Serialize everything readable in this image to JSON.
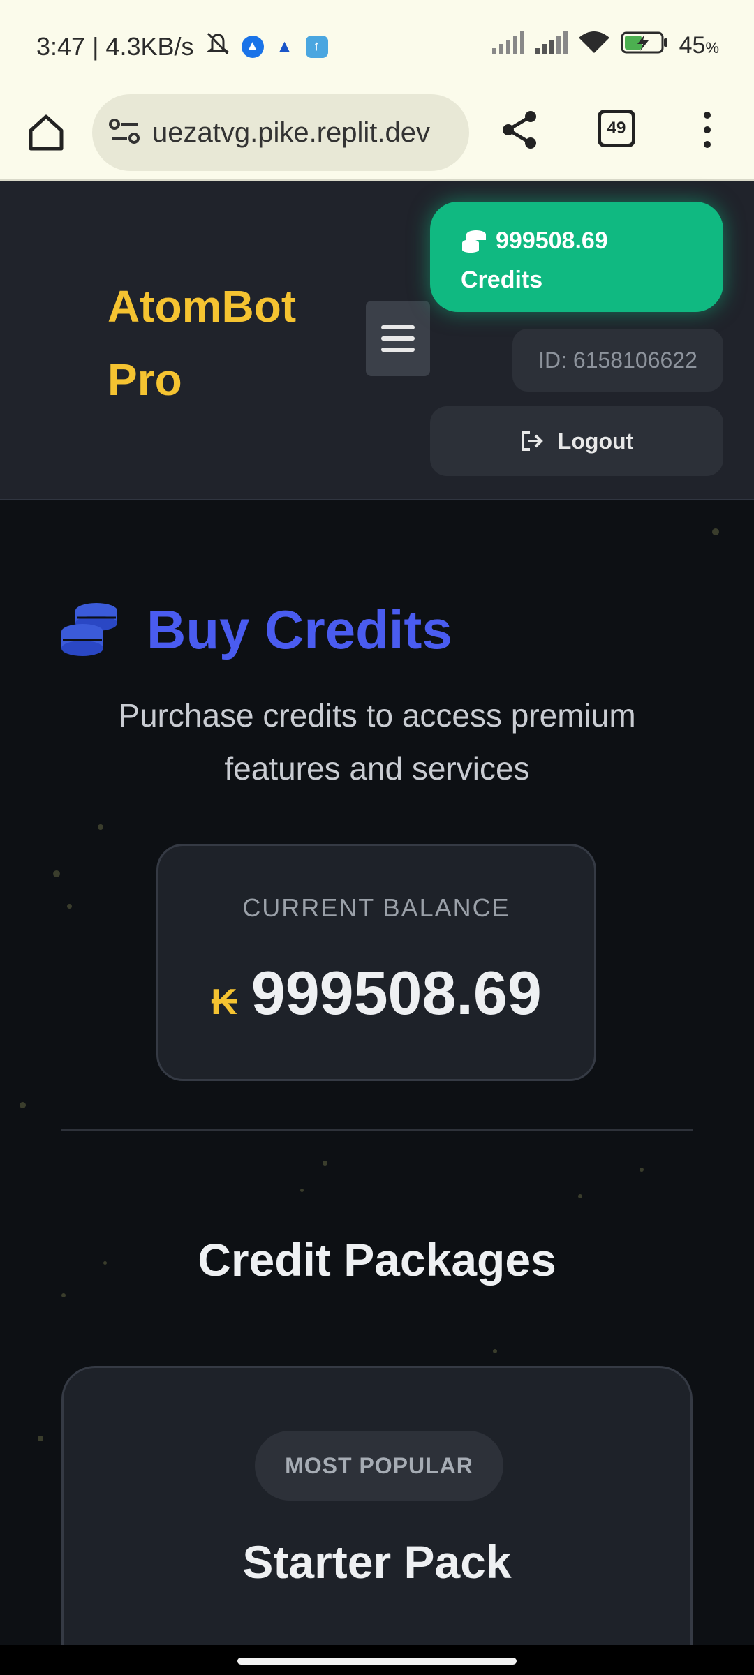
{
  "status_bar": {
    "time_speed": "3:47 | 4.3KB/s",
    "battery": "45",
    "battery_unit": "%"
  },
  "browser": {
    "url": "uezatvg.pike.replit.dev",
    "tab_count": "49"
  },
  "header": {
    "brand_line1": "AtomBot",
    "brand_line2": "Pro",
    "credits_amount": "999508.69",
    "credits_label": "Credits",
    "user_id": "ID: 6158106622",
    "logout_label": "Logout"
  },
  "main": {
    "title": "Buy Credits",
    "subtitle": "Purchase credits to access premium features and services",
    "balance": {
      "label": "CURRENT BALANCE",
      "symbol": "₭",
      "value": "999508.69"
    },
    "packages_title": "Credit Packages",
    "package": {
      "badge": "MOST POPULAR",
      "name": "Starter Pack"
    }
  },
  "colors": {
    "brand": "#f5c331",
    "accent_green": "#10b981",
    "title_blue": "#4a5cf0"
  }
}
